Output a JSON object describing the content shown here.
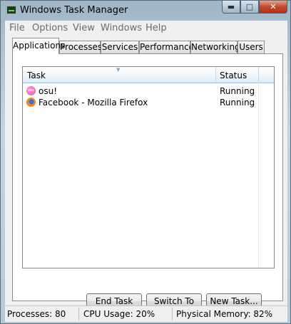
{
  "window": {
    "title": "Windows Task Manager",
    "minimize_glyph": "▬",
    "maximize_glyph": "□",
    "close_glyph": "✕"
  },
  "menu": [
    "File",
    "Options",
    "View",
    "Windows",
    "Help"
  ],
  "tabs": [
    "Applications",
    "Processes",
    "Services",
    "Performance",
    "Networking",
    "Users"
  ],
  "active_tab": "Applications",
  "list": {
    "columns": {
      "task": "Task",
      "status": "Status"
    },
    "rows": [
      {
        "name": "osu!",
        "status": "Running",
        "icon": "osu-icon"
      },
      {
        "name": "Facebook - Mozilla Firefox",
        "status": "Running",
        "icon": "firefox-icon"
      }
    ]
  },
  "buttons": {
    "end_task": "End Task",
    "switch_to": "Switch To",
    "new_task": "New Task..."
  },
  "status": {
    "processes": "Processes: 80",
    "cpu": "CPU Usage: 20%",
    "memory": "Physical Memory: 82%"
  },
  "colors": {
    "accent": "#c24a2c",
    "header_gradient_end": "#d9ecf8"
  }
}
